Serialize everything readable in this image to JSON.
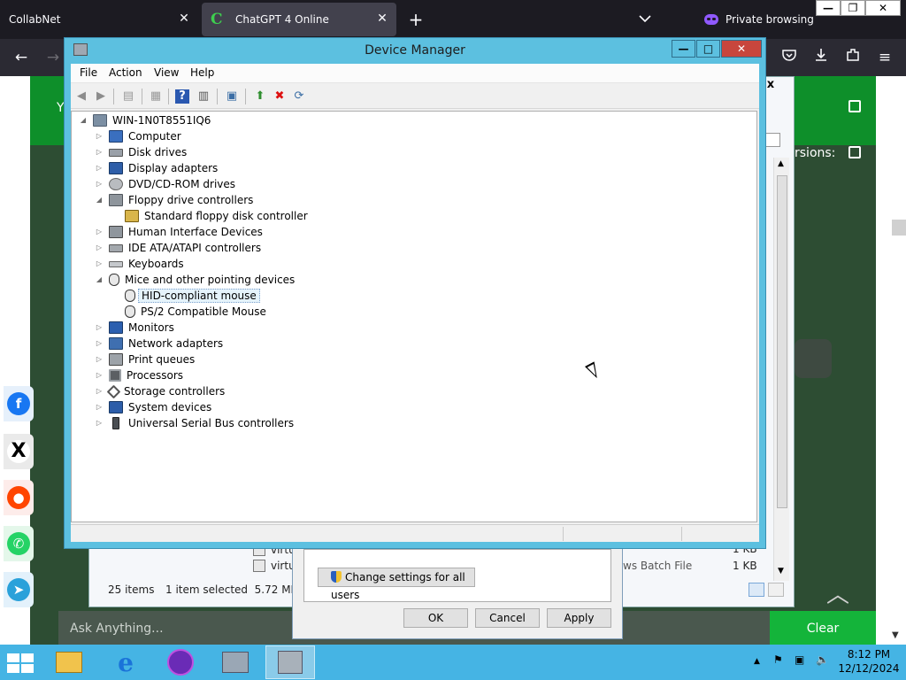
{
  "browser": {
    "tabs": [
      {
        "label": "CollabNet"
      },
      {
        "label": "ChatGPT 4 Online",
        "favicon": "C"
      }
    ],
    "private_label": "Private browsing",
    "window_controls": {
      "minimize": "—",
      "maximize": "❐",
      "close": "✕"
    }
  },
  "page": {
    "header_fragment": "Y",
    "versions_text": "rsions:",
    "ask_placeholder": "Ask Anything...",
    "clear_label": "Clear",
    "share_icons": [
      "facebook-icon",
      "x-icon",
      "reddit-icon",
      "whatsapp-icon",
      "telegram-icon"
    ]
  },
  "explorer": {
    "close_glyph": "x",
    "files": [
      {
        "name": "virtu",
        "type": "",
        "size": "1 KB"
      },
      {
        "name": "virtu",
        "type": "ws Batch File",
        "size": "1 KB"
      }
    ],
    "status_items": "25 items",
    "status_selected": "1 item selected  5.72 MB"
  },
  "properties": {
    "change_settings_label": "Change settings for all users",
    "ok_label": "OK",
    "cancel_label": "Cancel",
    "apply_label": "Apply"
  },
  "device_manager": {
    "title": "Device Manager",
    "menu": [
      "File",
      "Action",
      "View",
      "Help"
    ],
    "root": "WIN-1N0T8551IQ6",
    "tree": [
      {
        "label": "Computer",
        "expanded": false
      },
      {
        "label": "Disk drives",
        "expanded": false
      },
      {
        "label": "Display adapters",
        "expanded": false
      },
      {
        "label": "DVD/CD-ROM drives",
        "expanded": false
      },
      {
        "label": "Floppy drive controllers",
        "expanded": true
      },
      {
        "label": "Standard floppy disk controller",
        "child": true
      },
      {
        "label": "Human Interface Devices",
        "expanded": false
      },
      {
        "label": "IDE ATA/ATAPI controllers",
        "expanded": false
      },
      {
        "label": "Keyboards",
        "expanded": false
      },
      {
        "label": "Mice and other pointing devices",
        "expanded": true
      },
      {
        "label": "HID-compliant mouse",
        "child": true,
        "selected": true
      },
      {
        "label": "PS/2 Compatible Mouse",
        "child": true
      },
      {
        "label": "Monitors",
        "expanded": false
      },
      {
        "label": "Network adapters",
        "expanded": false
      },
      {
        "label": "Print queues",
        "expanded": false
      },
      {
        "label": "Processors",
        "expanded": false
      },
      {
        "label": "Storage controllers",
        "expanded": false
      },
      {
        "label": "System devices",
        "expanded": false
      },
      {
        "label": "Universal Serial Bus controllers",
        "expanded": false
      }
    ]
  },
  "taskbar": {
    "time": "8:12 PM",
    "date": "12/12/2024"
  },
  "colors": {
    "accent_green": "#0f9d2e",
    "window_frame": "#5cc0e0",
    "close_red": "#c8463d",
    "taskbar": "#45b4e4"
  }
}
